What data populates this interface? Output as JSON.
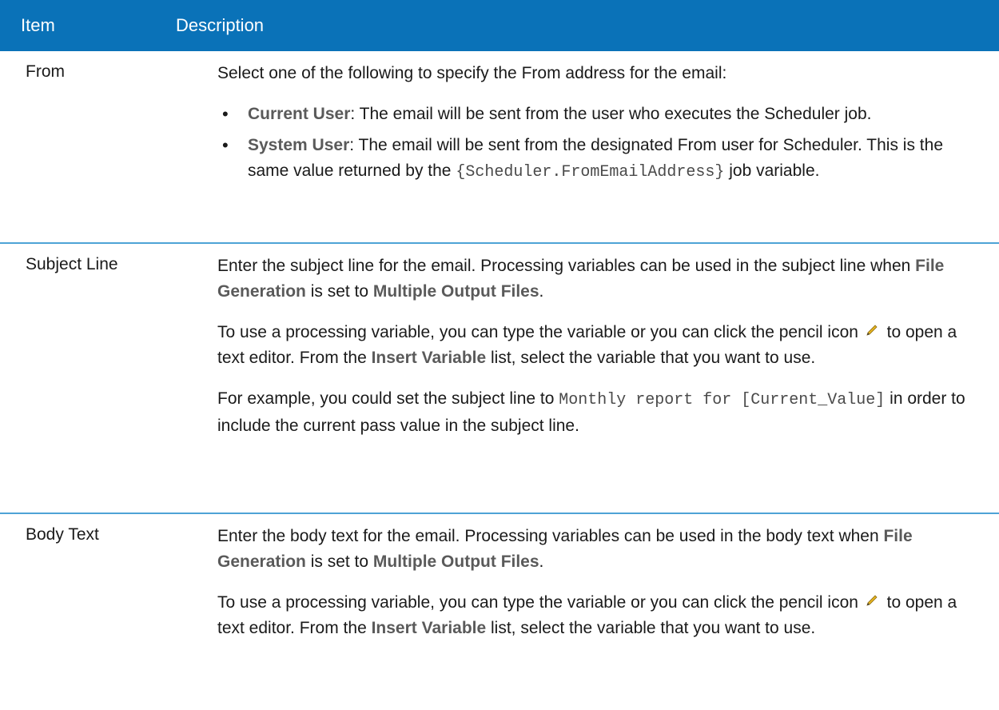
{
  "header": {
    "item": "Item",
    "description": "Description"
  },
  "from": {
    "label": "From",
    "intro": "Select one of the following to specify the From address for the email:",
    "current_user": {
      "term": "Current User",
      "text": ": The email will be sent from the user who executes the Scheduler job."
    },
    "system_user": {
      "term": "System User",
      "text": ": The email will be sent from the designated From user for Scheduler. This is the same value returned by the ",
      "code": "{Scheduler.FromEmailAddress}",
      "tail": " job variable."
    }
  },
  "subject": {
    "label": "Subject Line",
    "p1": {
      "a": "Enter the subject line for the email. Processing variables can be used in the subject line when ",
      "b1": "File Generation",
      "c": " is set to ",
      "b2": "Multiple Output Files",
      "d": "."
    },
    "p2": {
      "a": "To use a processing variable, you can type the variable or you can click the pencil icon",
      "b": " to open a text editor. From the ",
      "bold": "Insert Variable",
      "c": " list, select the variable that you want to use."
    },
    "p3": {
      "a": "For example, you could set the subject line to ",
      "code": "Monthly report for [Current_Value]",
      "b": " in order to include the current pass value in the subject line."
    }
  },
  "body": {
    "label": "Body Text",
    "p1": {
      "a": "Enter the body text for the email. Processing variables can be used in the body text when ",
      "b1": "File Generation",
      "c": " is set to ",
      "b2": "Multiple Output Files",
      "d": "."
    },
    "p2": {
      "a": "To use a processing variable, you can type the variable or you can click the pencil icon",
      "b": " to open a text editor. From the ",
      "bold": "Insert Variable",
      "c": " list, select the variable that you want to use."
    }
  },
  "colors": {
    "header_bg": "#0a72b8",
    "row_border": "#4ea3d6"
  },
  "icons": [
    "bullet-icon",
    "pencil-icon"
  ]
}
